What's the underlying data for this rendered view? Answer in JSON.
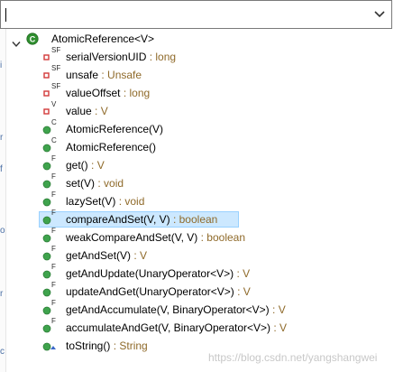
{
  "search": {
    "value": "",
    "placeholder": ""
  },
  "tree": {
    "class_name": "AtomicReference<V>",
    "members": [
      {
        "kind": "field-private",
        "mods": "SF",
        "name": "serialVersionUID",
        "type": " : long",
        "selected": false
      },
      {
        "kind": "field-private",
        "mods": "SF",
        "name": "unsafe",
        "type": " : Unsafe",
        "selected": false
      },
      {
        "kind": "field-private",
        "mods": "SF",
        "name": "valueOffset",
        "type": " : long",
        "selected": false
      },
      {
        "kind": "field-private",
        "mods": "V",
        "name": "value",
        "type": " : V",
        "selected": false
      },
      {
        "kind": "method-public",
        "mods": "C",
        "name": "AtomicReference(V)",
        "type": "",
        "selected": false
      },
      {
        "kind": "method-public",
        "mods": "C",
        "name": "AtomicReference()",
        "type": "",
        "selected": false
      },
      {
        "kind": "method-public",
        "mods": "F",
        "name": "get()",
        "type": " : V",
        "selected": false
      },
      {
        "kind": "method-public",
        "mods": "F",
        "name": "set(V)",
        "type": " : void",
        "selected": false
      },
      {
        "kind": "method-public",
        "mods": "F",
        "name": "lazySet(V)",
        "type": " : void",
        "selected": false
      },
      {
        "kind": "method-public",
        "mods": "F",
        "name": "compareAndSet(V, V)",
        "type": " : boolean",
        "selected": true
      },
      {
        "kind": "method-public",
        "mods": "F",
        "name": "weakCompareAndSet(V, V)",
        "type": " : boolean",
        "selected": false
      },
      {
        "kind": "method-public",
        "mods": "F",
        "name": "getAndSet(V)",
        "type": " : V",
        "selected": false
      },
      {
        "kind": "method-public",
        "mods": "F",
        "name": "getAndUpdate(UnaryOperator<V>)",
        "type": " : V",
        "selected": false
      },
      {
        "kind": "method-public",
        "mods": "F",
        "name": "updateAndGet(UnaryOperator<V>)",
        "type": " : V",
        "selected": false
      },
      {
        "kind": "method-public",
        "mods": "F",
        "name": "getAndAccumulate(V, BinaryOperator<V>)",
        "type": " : V",
        "selected": false
      },
      {
        "kind": "method-public",
        "mods": "F",
        "name": "accumulateAndGet(V, BinaryOperator<V>)",
        "type": " : V",
        "selected": false
      },
      {
        "kind": "method-public-override",
        "mods": "",
        "name": "toString()",
        "type": " : String",
        "selected": false
      }
    ]
  },
  "left_strip_marks": [
    "i",
    "r",
    "f",
    "o",
    "r",
    "c"
  ],
  "watermark": "https://blog.csdn.net/yangshangwei",
  "colors": {
    "public_method": "#3fa34d",
    "private_field": "#d23a3a",
    "selection": "#cce8ff",
    "type_text": "#8f6a2a",
    "class_icon": "#2f8f2f"
  }
}
